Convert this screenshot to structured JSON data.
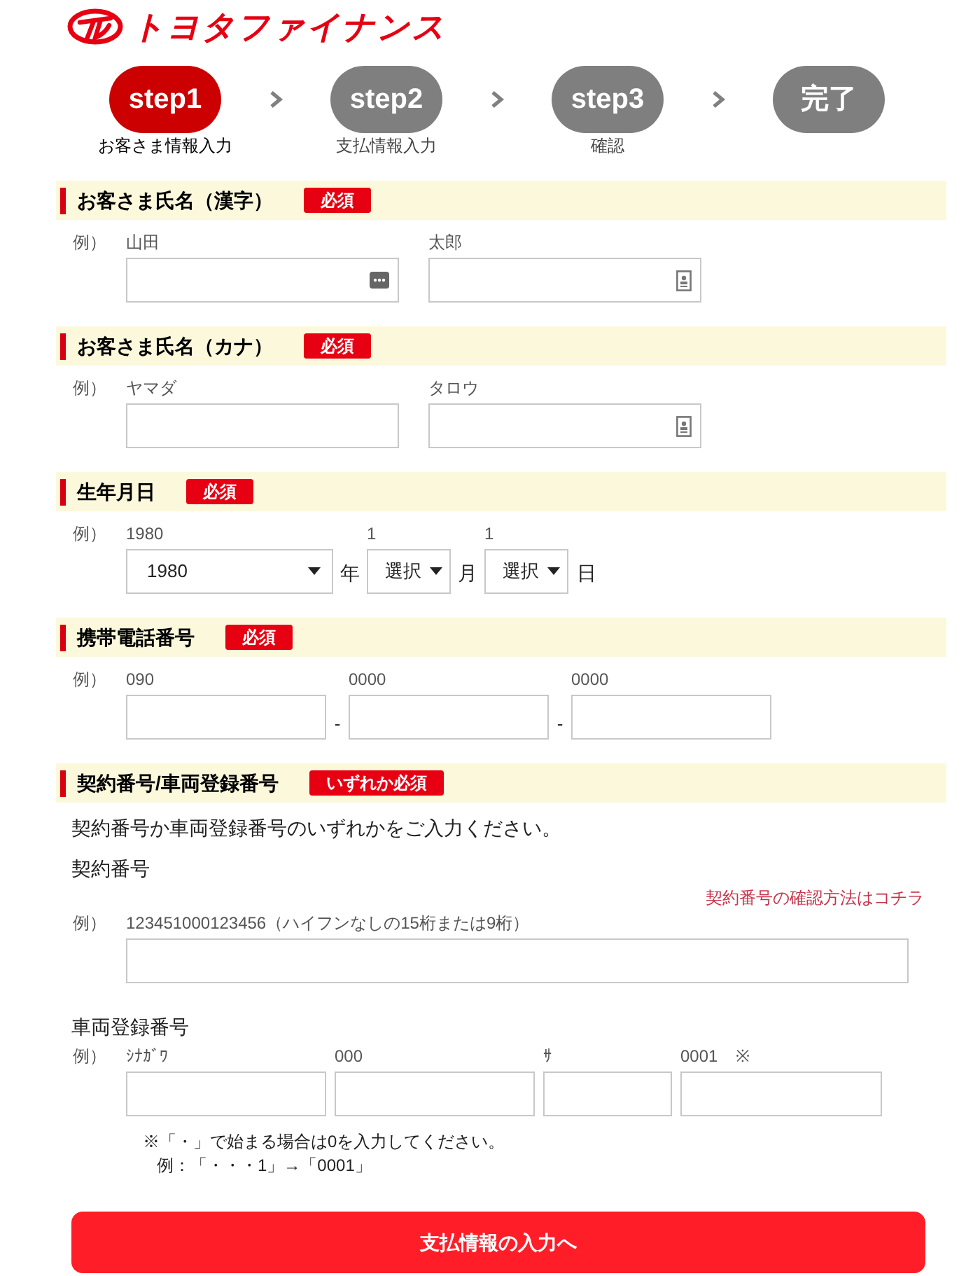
{
  "logo": {
    "text": "トヨタファイナンス"
  },
  "steps": [
    {
      "label": "step1",
      "caption": "お客さま情報入力",
      "selected": true
    },
    {
      "label": "step2",
      "caption": "支払情報入力",
      "selected": false
    },
    {
      "label": "step3",
      "caption": "確認",
      "selected": false
    },
    {
      "label": "完了",
      "selected": false
    }
  ],
  "sections": [
    {
      "kind": "name",
      "title": "お客さま氏名（漢字）",
      "badge": "必須",
      "example_label": "例）",
      "fields": [
        {
          "example": "山田",
          "kind": "dots"
        },
        {
          "example": "太郎",
          "kind": "card"
        }
      ]
    },
    {
      "kind": "name",
      "title": "お客さま氏名（カナ）",
      "badge": "必須",
      "example_label": "例）",
      "fields": [
        {
          "example": "ヤマダ",
          "kind": "plain"
        },
        {
          "example": "タロウ",
          "kind": "card"
        }
      ]
    },
    {
      "kind": "date",
      "title": "生年月日",
      "badge": "必須",
      "example_label": "例）",
      "selects": [
        {
          "example": "1980",
          "value": "1980",
          "unit": "年"
        },
        {
          "example": "1",
          "value": "選択",
          "unit": "月"
        },
        {
          "example": "1",
          "value": "選択",
          "unit": "日"
        }
      ]
    },
    {
      "kind": "phone",
      "title": "携帯電話番号",
      "badge": "必須",
      "example_label": "例）",
      "fields": [
        {
          "example": "090"
        },
        {
          "example": "0000",
          "prefix": "-"
        },
        {
          "example": "0000",
          "prefix": "-"
        }
      ]
    },
    {
      "kind": "ids",
      "title": "契約番号/車両登録番号",
      "badge": "いずれか必須",
      "intro": "契約番号か車両登録番号のいずれかをご入力ください。",
      "contract": {
        "heading": "契約番号",
        "link": "契約番号の確認方法はコチラ",
        "example_label": "例）",
        "example": "123451000123456（ハイフンなしの15桁または9桁）"
      },
      "vehicle": {
        "heading": "車両登録番号",
        "example_label": "例）",
        "fields": [
          {
            "example": "ｼﾅｶﾞﾜ"
          },
          {
            "example": "000"
          },
          {
            "example": "ｻ"
          },
          {
            "example": "0001",
            "mark": "※"
          }
        ],
        "notes": [
          "※「・」で始まる場合は0を入力してください。",
          "例：「・・・1」→「0001」"
        ]
      }
    }
  ],
  "submit": {
    "label": "支払情報の入力へ"
  }
}
